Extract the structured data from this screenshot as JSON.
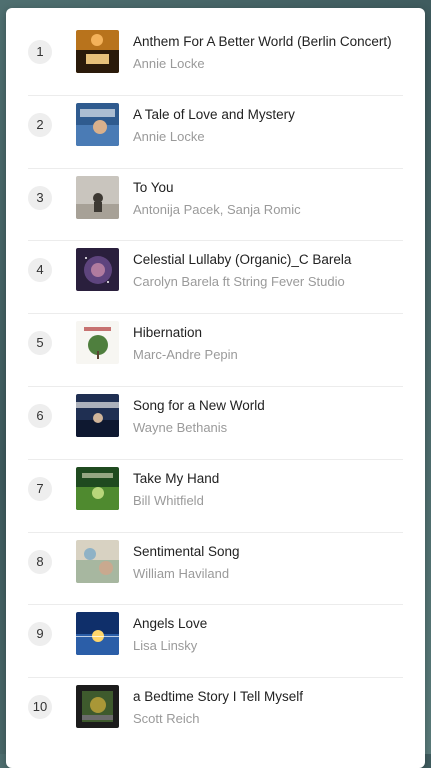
{
  "tracks": [
    {
      "num": "1",
      "title": "Anthem For A Better World (Berlin Concert)",
      "artist": "Annie Locke"
    },
    {
      "num": "2",
      "title": "A Tale of Love and Mystery",
      "artist": "Annie Locke"
    },
    {
      "num": "3",
      "title": "To You",
      "artist": "Antonija Pacek, Sanja Romic"
    },
    {
      "num": "4",
      "title": "Celestial Lullaby (Organic)_C Barela",
      "artist": "Carolyn Barela ft String Fever Studio"
    },
    {
      "num": "5",
      "title": "Hibernation",
      "artist": "Marc-Andre Pepin"
    },
    {
      "num": "6",
      "title": "Song for a New World",
      "artist": "Wayne Bethanis"
    },
    {
      "num": "7",
      "title": "Take My Hand",
      "artist": "Bill Whitfield"
    },
    {
      "num": "8",
      "title": "Sentimental Song",
      "artist": "William Haviland"
    },
    {
      "num": "9",
      "title": "Angels Love",
      "artist": "Lisa Linsky"
    },
    {
      "num": "10",
      "title": "a Bedtime Story I Tell Myself",
      "artist": "Scott Reich"
    }
  ]
}
